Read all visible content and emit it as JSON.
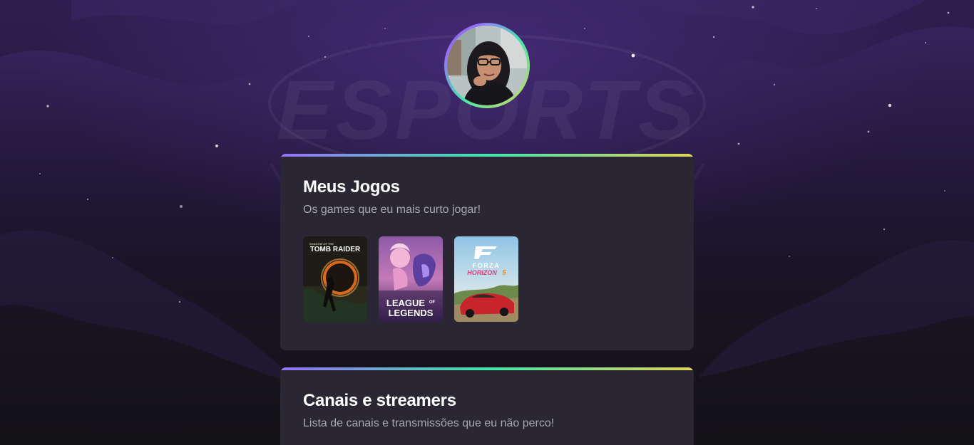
{
  "profile": {
    "avatar_alt": "Foto de perfil"
  },
  "background": {
    "watermark_text": "ESPORTS"
  },
  "games_card": {
    "title": "Meus Jogos",
    "subtitle": "Os games que eu mais curto jogar!",
    "games": [
      {
        "name": "Shadow of the Tomb Raider",
        "cover_text": "TOMB RAIDER",
        "cover_small": "SHADOW OF THE"
      },
      {
        "name": "League of Legends",
        "cover_line1": "LEAGUE",
        "cover_of": "OF",
        "cover_line2": "LEGENDS"
      },
      {
        "name": "Forza Horizon 5",
        "cover_line1": "FORZA",
        "cover_line2": "HORIZON",
        "cover_num": "5"
      }
    ]
  },
  "channels_card": {
    "title": "Canais e streamers",
    "subtitle": "Lista de canais e transmissões que eu não perco!"
  },
  "colors": {
    "accent_purple": "#9572fc",
    "accent_green": "#43e7ad",
    "accent_yellow": "#e2d45c",
    "card_bg": "#2a2634"
  }
}
